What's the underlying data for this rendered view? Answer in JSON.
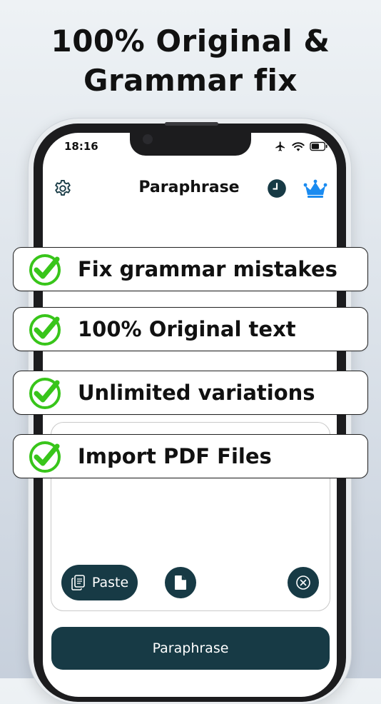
{
  "headline": {
    "line1": "100% Original &",
    "line2": "Grammar fix"
  },
  "status_bar": {
    "time": "18:16",
    "icons": [
      "airplane-icon",
      "wifi-icon",
      "battery-icon"
    ]
  },
  "app": {
    "title": "Paraphrase",
    "left_icon": "gear-icon",
    "right_icons": [
      "history-clock-icon",
      "crown-icon"
    ],
    "accent": "#1a8bf0"
  },
  "features": [
    {
      "label": "Fix grammar mistakes",
      "icon": "checkmark-icon"
    },
    {
      "label": "100% Original text",
      "icon": "checkmark-icon"
    },
    {
      "label": "Unlimited variations",
      "icon": "checkmark-icon"
    },
    {
      "label": "Import PDF Files",
      "icon": "checkmark-icon"
    }
  ],
  "input_actions": {
    "paste_label": "Paste",
    "file_icon": "document-icon",
    "clear_icon": "clear-circle-icon"
  },
  "primary_button": {
    "label": "Paraphrase"
  },
  "colors": {
    "button_bg": "#173a45",
    "check_green": "#38c51a",
    "crown_blue": "#1a8bf0"
  }
}
